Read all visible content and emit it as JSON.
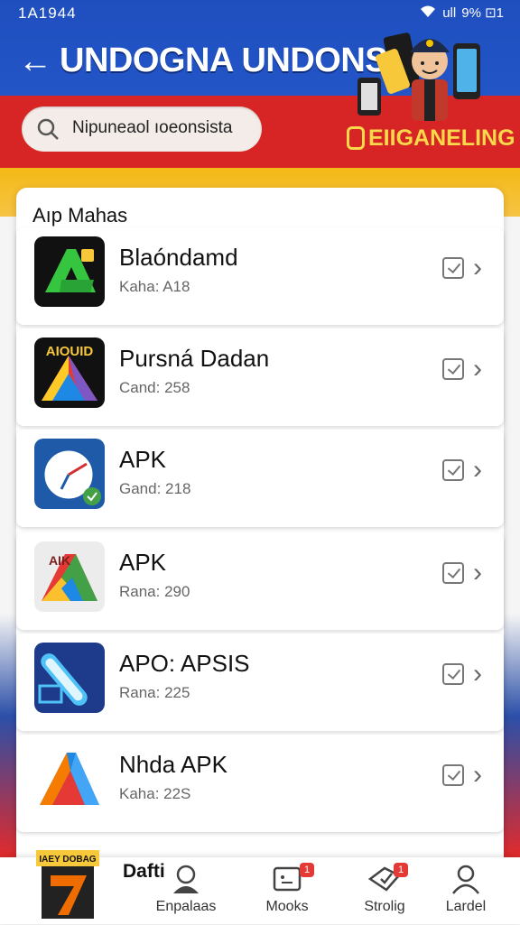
{
  "status": {
    "time": "1A1944",
    "battery": "9% ⊡1",
    "signal": "ull"
  },
  "header": {
    "title": "UNDOGNA UNDONSIA",
    "back_label": "←"
  },
  "search": {
    "value": "Nipuneaol ıoeonsista"
  },
  "brand": {
    "label": "EIIGANELING"
  },
  "section": {
    "title": "Aıp Mahas"
  },
  "apps": [
    {
      "name": "Blaóndamd",
      "sub": "Kaha: A18"
    },
    {
      "name": "Pursná Dadan",
      "sub": "Cand: 258"
    },
    {
      "name": "APK",
      "sub": "Gand: 218"
    },
    {
      "name": "APK",
      "sub": "Rana: 290"
    },
    {
      "name": "APO: APSIS",
      "sub": "Rana: 225"
    },
    {
      "name": "Nhda APK",
      "sub": "Kaha: 22S"
    }
  ],
  "app_icon_texts": {
    "pursna": "AIOUID",
    "apk2": "AIK"
  },
  "bottom_nav": {
    "app_badge": "IAEY DOBAG",
    "dafti": "Dafti",
    "items": [
      {
        "label": "Enpalaas",
        "badge": ""
      },
      {
        "label": "Mooks",
        "badge": "1"
      },
      {
        "label": "Strolig",
        "badge": "1"
      },
      {
        "label": "Lardel",
        "badge": ""
      }
    ]
  },
  "colors": {
    "blue": "#2355c7",
    "red": "#d72424",
    "yellow": "#f4b916",
    "badge": "#e53935"
  }
}
